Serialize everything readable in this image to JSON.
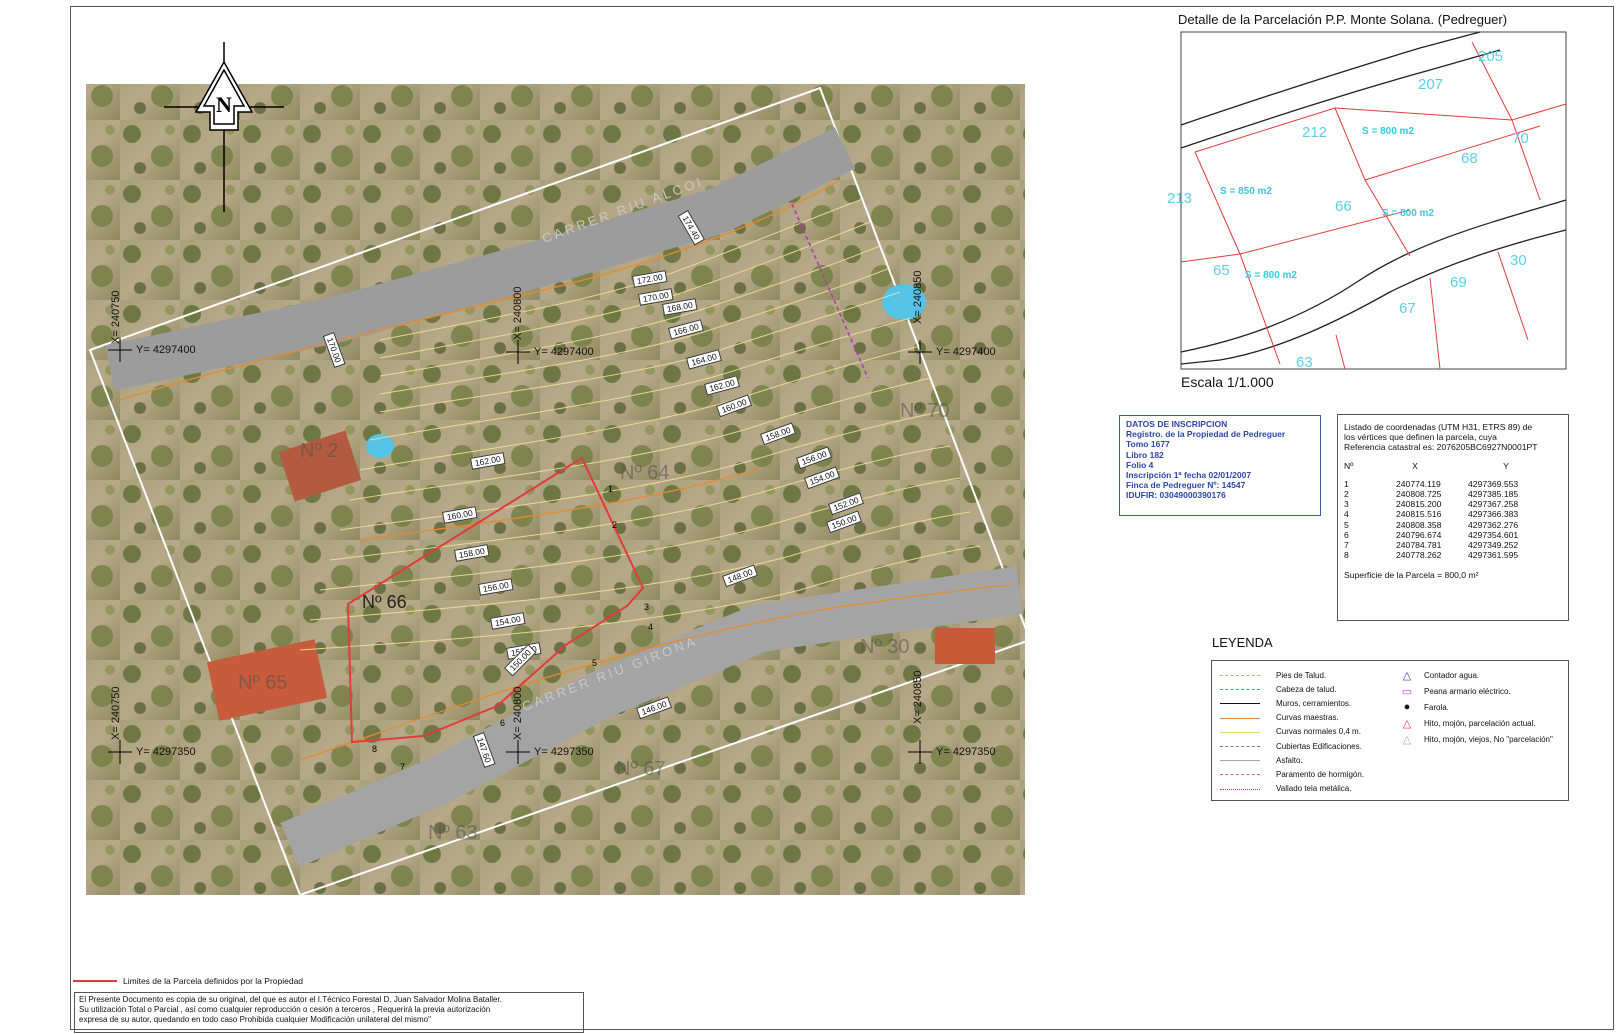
{
  "detail": {
    "title": "Detalle de la Parcelación P.P. Monte Solana. (Pedreguer)",
    "scale": "Escala 1/1.000",
    "parcel_numbers": [
      "205",
      "207",
      "212",
      "70",
      "68",
      "213",
      "66",
      "65",
      "30",
      "69",
      "67",
      "63"
    ],
    "surfaces": [
      "S = 800 m2",
      "S = 850 m2",
      "S = 800 m2",
      "S = 800 m2"
    ]
  },
  "inscription": {
    "title": "DATOS DE INSCRIPCION",
    "lines": [
      "Registro. de la Propiedad de Pedreguer",
      "Tomo  1677",
      "Libro  182",
      "Folio  4",
      "Inscripción 1ª fecha 02/01/2007",
      "Finca de Pedreguer Nº: 14547",
      "IDUFIR: 03049000390176"
    ]
  },
  "coordinates": {
    "intro": [
      "Listado de coordenadas (UTM  H31, ETRS 89)  de",
      "los vértices que definen la parcela, cuya",
      "Referencia catastral es: 2076205BC6927N0001PT"
    ],
    "headers": [
      "Nº",
      "X",
      "Y"
    ],
    "rows": [
      [
        "1",
        "240774.119",
        "4297369.553"
      ],
      [
        "2",
        "240808.725",
        "4297385.185"
      ],
      [
        "3",
        "240815.200",
        "4297367.258"
      ],
      [
        "4",
        "240815.516",
        "4297366.383"
      ],
      [
        "5",
        "240808.358",
        "4297362.276"
      ],
      [
        "6",
        "240796.674",
        "4297354.601"
      ],
      [
        "7",
        "240784.781",
        "4297349.252"
      ],
      [
        "8",
        "240778.262",
        "4297361.595"
      ]
    ],
    "surface": "Superficie de la Parcela = 800,0 m²"
  },
  "legend": {
    "title": "LEYENDA",
    "lines": [
      {
        "label": "Pies de Talud.",
        "color": "#d9a066",
        "style": "dashed"
      },
      {
        "label": "Cabeza de talud.",
        "color": "#2fb85a",
        "style": "dashed"
      },
      {
        "label": "Muros, cerramientos.",
        "color": "#111111",
        "style": "solid"
      },
      {
        "label": "Curvas maestras.",
        "color": "#e58a2e",
        "style": "solid"
      },
      {
        "label": "Curvas normales 0,4 m.",
        "color": "#e8d36a",
        "style": "solid"
      },
      {
        "label": "Cubiertas Edificaciones.",
        "color": "#777777",
        "style": "dashed"
      },
      {
        "label": "Asfalto.",
        "color": "#aaaaaa",
        "style": "solid"
      },
      {
        "label": "Paramento de hormigón.",
        "color": "#e05a8a",
        "style": "dashdot"
      },
      {
        "label": "Vallado tela metálica.",
        "color": "#b03ab8",
        "style": "dotted"
      }
    ],
    "symbols": [
      {
        "label": "Contador agua.",
        "icon": "triangle-outline-icon",
        "color": "#2d46a8"
      },
      {
        "label": "Peana armario eléctrico.",
        "icon": "square-outline-icon",
        "color": "#c23ac2"
      },
      {
        "label": "Farola.",
        "icon": "lamp-icon",
        "color": "#111111"
      },
      {
        "label": "Hito, mojón, parcelación actual.",
        "icon": "triangle-red-icon",
        "color": "#e23b3b"
      },
      {
        "label": "Hito, mojón, viejos, No \"parcelación\"",
        "icon": "triangle-grey-icon",
        "color": "#aaaaaa"
      }
    ]
  },
  "map": {
    "streets": [
      "CARRER RIU ALCOI",
      "CARRER RIU GIRONA"
    ],
    "parcel_labels": [
      "Nº 2",
      "Nº 66",
      "Nº 65",
      "Nº 70",
      "Nº 30",
      "Nº 67",
      "Nº 63",
      "Nº 64"
    ],
    "grid_labels": [
      "X= 240750",
      "X= 240800",
      "X= 240850",
      "Y= 4297400",
      "Y= 4297350"
    ],
    "contours": [
      "174.40",
      "172.00",
      "170.00",
      "168.00",
      "166.00",
      "164.00",
      "162.00",
      "160.00",
      "158.00",
      "156.00",
      "154.00",
      "152.00",
      "150.00",
      "170.00",
      "162.00",
      "160.00",
      "158.00",
      "156.00",
      "154.00",
      "152.00",
      "150.00",
      "148.00",
      "147.60",
      "146.00"
    ],
    "vertex_numbers": [
      "1",
      "2",
      "3",
      "4",
      "5",
      "6",
      "7",
      "8"
    ]
  },
  "footer": {
    "limits_label": "Limites de la Parcela definidos por la Propiedad",
    "notice": [
      "El Presente Documento es copia de su original, del que es autor el I.Técnico Forestal D. Juan Salvador Molina Bataller.",
      "Su utilización Total o Parcial , así como cualquier reproducción o cesión a terceros , Requerirá la previa autorización",
      "expresa de su autor, quedando en todo caso Prohibida cualquier Modificación unilateral del mismo\""
    ]
  }
}
